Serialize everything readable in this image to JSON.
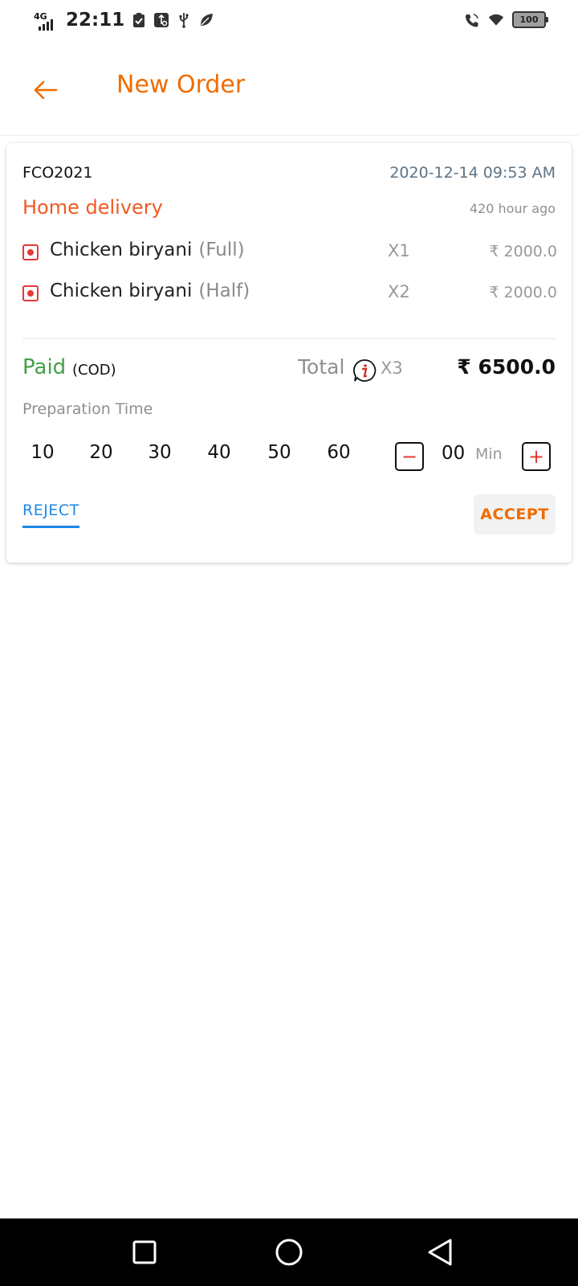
{
  "status_bar": {
    "network": "4G",
    "time": "22:11",
    "battery": "100",
    "icons": [
      "signal-icon",
      "clipboard-check-icon",
      "usb-settings-icon",
      "usb-icon",
      "leaf-icon",
      "wifi-call-icon",
      "wifi-icon",
      "battery-icon"
    ]
  },
  "header": {
    "title": "New Order",
    "back_icon": "arrow-left-icon"
  },
  "order": {
    "id": "FCO2021",
    "datetime": "2020-12-14 09:53 AM",
    "delivery_type": "Home delivery",
    "time_ago": "420 hour ago",
    "items": [
      {
        "name": "Chicken biryani",
        "variant": "(Full)",
        "qty": "X1",
        "price": "₹ 2000.0"
      },
      {
        "name": "Chicken biryani",
        "variant": "(Half)",
        "qty": "X2",
        "price": "₹ 2000.0"
      }
    ],
    "payment_status": "Paid",
    "payment_method": "(COD)",
    "total_label": "Total",
    "total_qty": "X3",
    "total_amount": "₹ 6500.0"
  },
  "preparation": {
    "label": "Preparation Time",
    "options": [
      "10",
      "20",
      "30",
      "40",
      "50",
      "60"
    ],
    "minus": "−",
    "plus": "+",
    "minutes": "00",
    "unit": "Min"
  },
  "actions": {
    "reject": "REJECT",
    "accept": "ACCEPT"
  },
  "colors": {
    "accent_orange": "#ef6c00",
    "delivery_red": "#ef5a22",
    "paid_green": "#43a047",
    "reject_blue": "#1e88e5",
    "date_slate": "#5c7385"
  },
  "nav_bar": {
    "icons": [
      "recents-square-icon",
      "home-circle-icon",
      "back-triangle-icon"
    ]
  }
}
